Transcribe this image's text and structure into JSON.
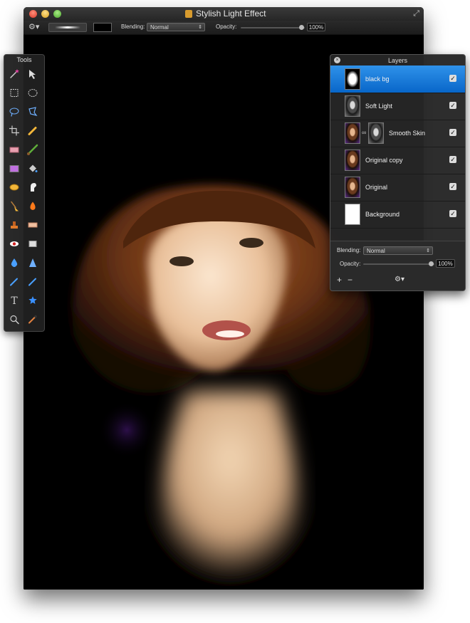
{
  "window": {
    "title": "Stylish Light Effect"
  },
  "toolbar": {
    "blending_label": "Blending:",
    "blending_value": "Normal",
    "opacity_label": "Opacity:",
    "opacity_value": "100%",
    "opacity_level": 1.0
  },
  "tools_panel": {
    "title": "Tools",
    "tools": [
      "magic-wand-icon",
      "move-icon",
      "rectangle-select-icon",
      "ellipse-select-icon",
      "lasso-icon",
      "polygon-lasso-icon",
      "crop-icon",
      "pencil-icon",
      "eraser-icon",
      "brush-icon",
      "gradient-icon",
      "paint-bucket-icon",
      "color-pill-icon",
      "smudge-icon",
      "broom-icon",
      "burn-icon",
      "stamp-icon",
      "bandage-icon",
      "red-eye-icon",
      "eraser-block-icon",
      "water-drop-icon",
      "cone-icon",
      "pen-icon",
      "pen-icon",
      "text-icon",
      "star-icon",
      "zoom-icon",
      "eyedropper-icon"
    ]
  },
  "layers_panel": {
    "title": "Layers",
    "layers": [
      {
        "name": "black bg",
        "selected": true,
        "visible": true,
        "thumb": "black",
        "mask": false
      },
      {
        "name": "Soft Light",
        "selected": false,
        "visible": true,
        "thumb": "bw",
        "mask": false
      },
      {
        "name": "Smooth Skin",
        "selected": false,
        "visible": true,
        "thumb": "portrait",
        "mask": true
      },
      {
        "name": "Original copy",
        "selected": false,
        "visible": true,
        "thumb": "portrait",
        "mask": false
      },
      {
        "name": "Original",
        "selected": false,
        "visible": true,
        "thumb": "portrait",
        "mask": false
      },
      {
        "name": "Background",
        "selected": false,
        "visible": true,
        "thumb": "white",
        "mask": false
      }
    ],
    "blending_label": "Blending:",
    "blending_value": "Normal",
    "opacity_label": "Opacity:",
    "opacity_value": "100%",
    "opacity_level": 1.0,
    "check_glyph": "✓",
    "add_glyph": "+",
    "remove_glyph": "−",
    "gear_glyph": "⚙",
    "close_glyph": "×"
  },
  "colors": {
    "selection": "#1a7ee0",
    "hair": "#7a3e1c",
    "skin": "#f2d2b0"
  }
}
